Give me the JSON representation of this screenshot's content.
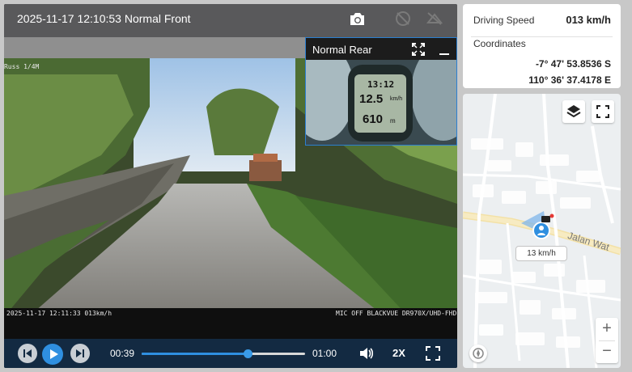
{
  "video": {
    "title": "2025-11-17 12:10:53 Normal Front",
    "top_left_label": "Russ 1/4M",
    "bottom_left_stamp": "2025-11-17 12:11:33 013km/h",
    "bottom_right_stamp": "MIC OFF BLACKVUE DR970X/UHD-FHD",
    "rear": {
      "title": "Normal Rear",
      "gauge_time": "13:12",
      "gauge_speed": "12.5",
      "gauge_speed_unit": "km/h",
      "gauge_distance": "610",
      "gauge_distance_unit": "m"
    },
    "icons": [
      "camera-icon",
      "disabled-icon",
      "disabled-icon",
      "expand-icon",
      "minimize-icon"
    ]
  },
  "controls": {
    "current_time": "00:39",
    "end_time": "01:00",
    "progress": 0.65,
    "playback_speed": "2X",
    "icons": [
      "prev-icon",
      "play-icon",
      "next-icon",
      "volume-icon",
      "fullscreen-icon"
    ]
  },
  "info": {
    "speed_label": "Driving Speed",
    "speed_value": "013 km/h",
    "coords_label": "Coordinates",
    "lat": "-7° 47' 53.8536 S",
    "lon": "110° 36' 37.4178 E"
  },
  "map": {
    "road_name": "Jalan Wat",
    "speed_chip": "13 km/h",
    "zoom_in": "+",
    "zoom_out": "−",
    "icons": [
      "layers-icon",
      "fullscreen-icon",
      "compass-icon",
      "vehicle-marker-icon"
    ]
  },
  "colors": {
    "accent": "#2f8fe0",
    "controls_bg": "#132a42",
    "panel_bg": "#59595b"
  }
}
